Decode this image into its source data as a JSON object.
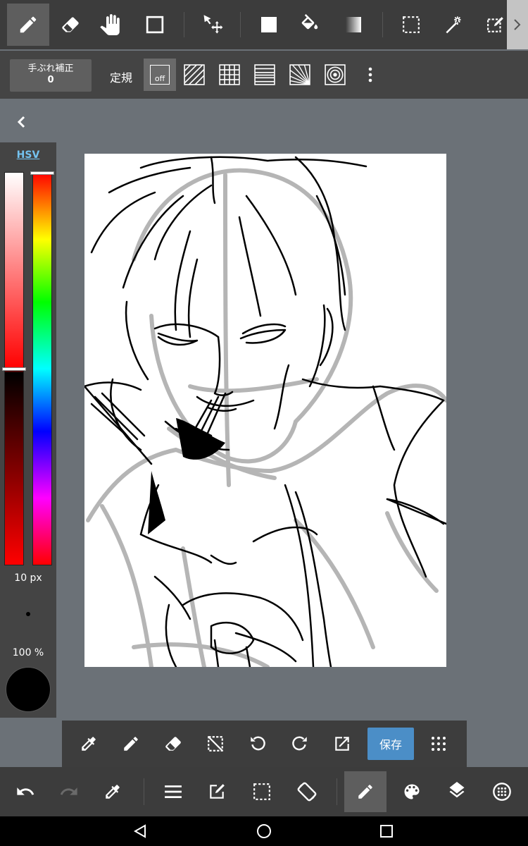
{
  "toolbar": {
    "tools": [
      "brush",
      "eraser",
      "hand",
      "shape",
      "move",
      "fill-rect",
      "bucket",
      "gradient",
      "select-rect",
      "magic-wand",
      "select-pen"
    ],
    "active_tool": "brush"
  },
  "stabilizer": {
    "label": "手ぶれ補正",
    "value": "0"
  },
  "ruler": {
    "label": "定規",
    "off_label": "off"
  },
  "color_panel": {
    "mode_label": "HSV",
    "brush_size": "10 px",
    "opacity": "100 %",
    "current_color": "#000000",
    "saturation_level": 0.5,
    "hue_level": 0.0
  },
  "actions": {
    "save_label": "保存"
  },
  "colors": {
    "accent": "#4b8ec7",
    "hsv_link": "#74c3f0"
  }
}
